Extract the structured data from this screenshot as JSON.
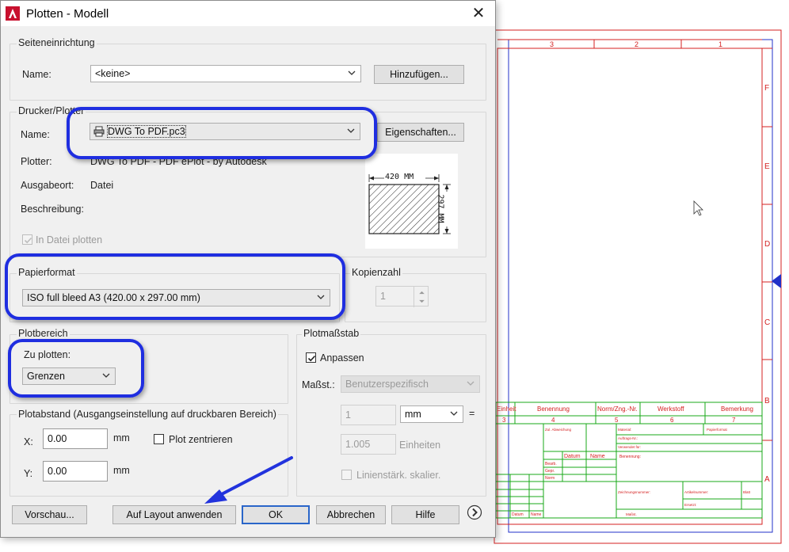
{
  "window": {
    "title": "Plotten - Modell",
    "icon": "autocad-icon",
    "close_glyph": "✕"
  },
  "page_setup": {
    "legend": "Seiteneinrichtung",
    "name_label": "Name:",
    "name_value": "<keine>",
    "add_button": "Hinzufügen..."
  },
  "printer": {
    "legend": "Drucker/Plotter",
    "name_label": "Name:",
    "name_value": "DWG To PDF.pc3",
    "properties_button": "Eigenschaften...",
    "plotter_label": "Plotter:",
    "plotter_value": "DWG To PDF - PDF ePlot - by Autodesk",
    "location_label": "Ausgabeort:",
    "location_value": "Datei",
    "description_label": "Beschreibung:",
    "plot_to_file_label": "In Datei plotten",
    "plot_to_file_checked": true,
    "preview_width": "420 MM",
    "preview_height": "297 MM"
  },
  "paper": {
    "legend": "Papierformat",
    "value": "ISO full bleed A3 (420.00 x 297.00 mm)"
  },
  "copies": {
    "legend": "Kopienzahl",
    "value": "1"
  },
  "plot_area": {
    "legend": "Plotbereich",
    "what_label": "Zu plotten:",
    "what_value": "Grenzen"
  },
  "plot_scale": {
    "legend": "Plotmaßstab",
    "fit_label": "Anpassen",
    "fit_checked": true,
    "scale_label": "Maßst.:",
    "scale_value": "Benutzerspezifisch",
    "value1": "1",
    "unit1": "mm",
    "equals": "=",
    "value2": "1.005",
    "unit2": "Einheiten",
    "lineweight_label": "Linienstärk. skalier."
  },
  "plot_offset": {
    "legend": "Plotabstand (Ausgangseinstellung auf druckbaren Bereich)",
    "x_label": "X:",
    "x_value": "0.00",
    "x_unit": "mm",
    "y_label": "Y:",
    "y_value": "0.00",
    "y_unit": "mm",
    "center_label": "Plot zentrieren"
  },
  "buttons": {
    "preview": "Vorschau...",
    "apply_layout": "Auf Layout anwenden",
    "ok": "OK",
    "cancel": "Abbrechen",
    "help": "Hilfe"
  },
  "drawing": {
    "top_zones": [
      "3",
      "2",
      "1"
    ],
    "side_zones": [
      "F",
      "E",
      "D",
      "C",
      "B",
      "A"
    ],
    "title_block": {
      "headers": [
        "Einheit",
        "Benennung",
        "Norm/Zng.-Nr.",
        "Werkstoff",
        "Bemerkung"
      ],
      "numbers": [
        "3",
        "4",
        "5",
        "6",
        "7"
      ],
      "labels": [
        "Zul. Abweichung",
        "Material:",
        "Papierformat",
        "Auftrags-Nr.:",
        "Verwendet für:",
        "Datum",
        "Name",
        "Benennung:",
        "Bearb.",
        "Gepr.",
        "Norm",
        "Zeichnungsnummer:",
        "Artikelnummer:",
        "Blatt",
        "Ersetzt:",
        "Maßst.",
        "Datum",
        "Name"
      ]
    }
  },
  "colors": {
    "highlight": "#1f2ee0",
    "arrow": "#2233dd",
    "frame_red": "#d42020",
    "frame_blue": "#2030c8",
    "table_green": "#18a818"
  }
}
